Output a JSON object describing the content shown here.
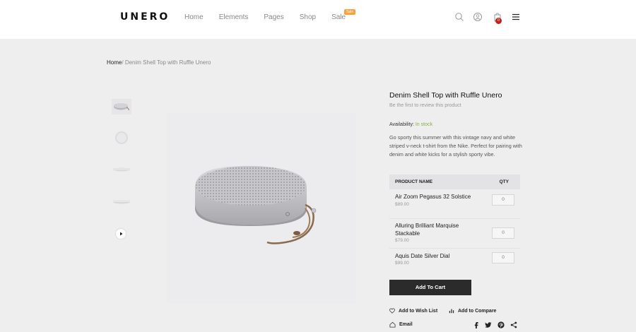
{
  "header": {
    "logo": "UNERO",
    "nav": [
      {
        "label": "Home"
      },
      {
        "label": "Elements"
      },
      {
        "label": "Pages"
      },
      {
        "label": "Shop"
      },
      {
        "label": "Sale",
        "badge": "Sale"
      }
    ],
    "cart_count": "0",
    "icons": [
      "search-icon",
      "user-icon",
      "cart-icon",
      "menu-icon"
    ]
  },
  "breadcrumb": {
    "home": "Home",
    "separator": "/",
    "current": "Denim Shell Top with Ruffle Unero"
  },
  "product": {
    "title": "Denim Shell Top with Ruffle Unero",
    "review_text": "Be the first to review this product",
    "availability_label": "Availability:",
    "availability_value": "In stock",
    "description": "Go sporty this summer with this vintage navy and white striped v-neck t-shirt from the Nike. Perfect for pairing with denim and white kicks for a stylish sporty vibe."
  },
  "grouped_table": {
    "headers": {
      "name": "PRODUCT NAME",
      "qty": "QTY"
    },
    "rows": [
      {
        "name": "Air Zoom Pegasus 32 Solstice",
        "price": "$89.00",
        "qty": "0"
      },
      {
        "name": "Alluring Brilliant Marquise Stackable",
        "price": "$79.00",
        "qty": "0"
      },
      {
        "name": "Aquis Date Silver Dial",
        "price": "$99.00",
        "qty": "0"
      }
    ]
  },
  "actions": {
    "add_to_cart": "Add To Cart",
    "wishlist": "Add to Wish List",
    "compare": "Add to Compare",
    "email": "Email"
  },
  "colors": {
    "accent_sale": "#f7a23b",
    "cart_badge": "#c0221b",
    "in_stock": "#7cb342",
    "button_dark": "#2b2b2b"
  }
}
